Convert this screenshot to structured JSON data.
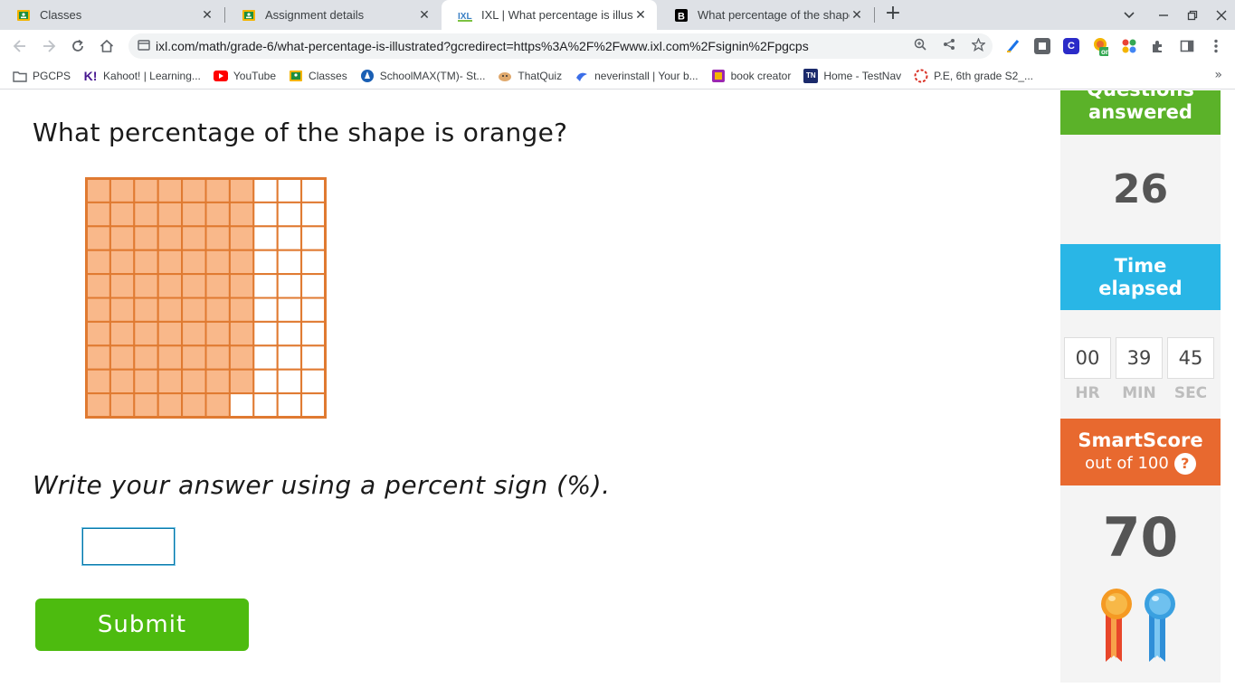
{
  "browser": {
    "tabs": [
      {
        "title": "Classes",
        "active": false
      },
      {
        "title": "Assignment details",
        "active": false
      },
      {
        "title": "IXL | What percentage is illustrat",
        "active": true
      },
      {
        "title": "What percentage of the shape is",
        "active": false
      }
    ],
    "url": "ixl.com/math/grade-6/what-percentage-is-illustrated?gcredirect=https%3A%2F%2Fwww.ixl.com%2Fsignin%2Fpgcps",
    "new_tab_symbol": "+"
  },
  "bookmarks": [
    {
      "label": "PGCPS",
      "icon": "folder-icon",
      "color": "#5f6368"
    },
    {
      "label": "Kahoot! | Learning...",
      "icon": "kahoot-icon",
      "color": "#46178f"
    },
    {
      "label": "YouTube",
      "icon": "youtube-icon",
      "color": "#ff0000"
    },
    {
      "label": "Classes",
      "icon": "google-classroom-icon",
      "color": "#f4b400"
    },
    {
      "label": "SchoolMAX(TM)- St...",
      "icon": "schoolmax-icon",
      "color": "#1a5fb4"
    },
    {
      "label": "ThatQuiz",
      "icon": "thatquiz-icon",
      "color": "#e0a96d"
    },
    {
      "label": "neverinstall | Your b...",
      "icon": "neverinstall-icon",
      "color": "#3b6ee8"
    },
    {
      "label": "book creator",
      "icon": "book-creator-icon",
      "color": "#9b27af"
    },
    {
      "label": "Home - TestNav",
      "icon": "testnav-icon",
      "color": "#1b2a6b"
    },
    {
      "label": "P.E, 6th grade S2_...",
      "icon": "pe-icon",
      "color": "#d93025"
    }
  ],
  "question": {
    "prompt": "What percentage of the shape is orange?",
    "instruction": "Write your answer using a percent sign (%).",
    "answer_value": "",
    "submit_label": "Submit"
  },
  "grid_model": {
    "rows": 10,
    "cols": 10,
    "shaded_count": 69,
    "fill_color": "#f9b88a",
    "border_color": "#e07a31"
  },
  "sidebar": {
    "questions_answered_label": "Questions answered",
    "questions_answered_value": "26",
    "time_elapsed_label": "Time elapsed",
    "timer": {
      "hr": "00",
      "min": "39",
      "sec": "45"
    },
    "timer_labels": {
      "hr": "HR",
      "min": "MIN",
      "sec": "SEC"
    },
    "smartscore_label": "SmartScore",
    "smartscore_sub": "out of 100",
    "smartscore_help": "?",
    "smartscore_value": "70"
  },
  "colors": {
    "green": "#5bb229",
    "blue": "#29b6e6",
    "orange": "#e8692f",
    "submit": "#4dbb0f"
  }
}
